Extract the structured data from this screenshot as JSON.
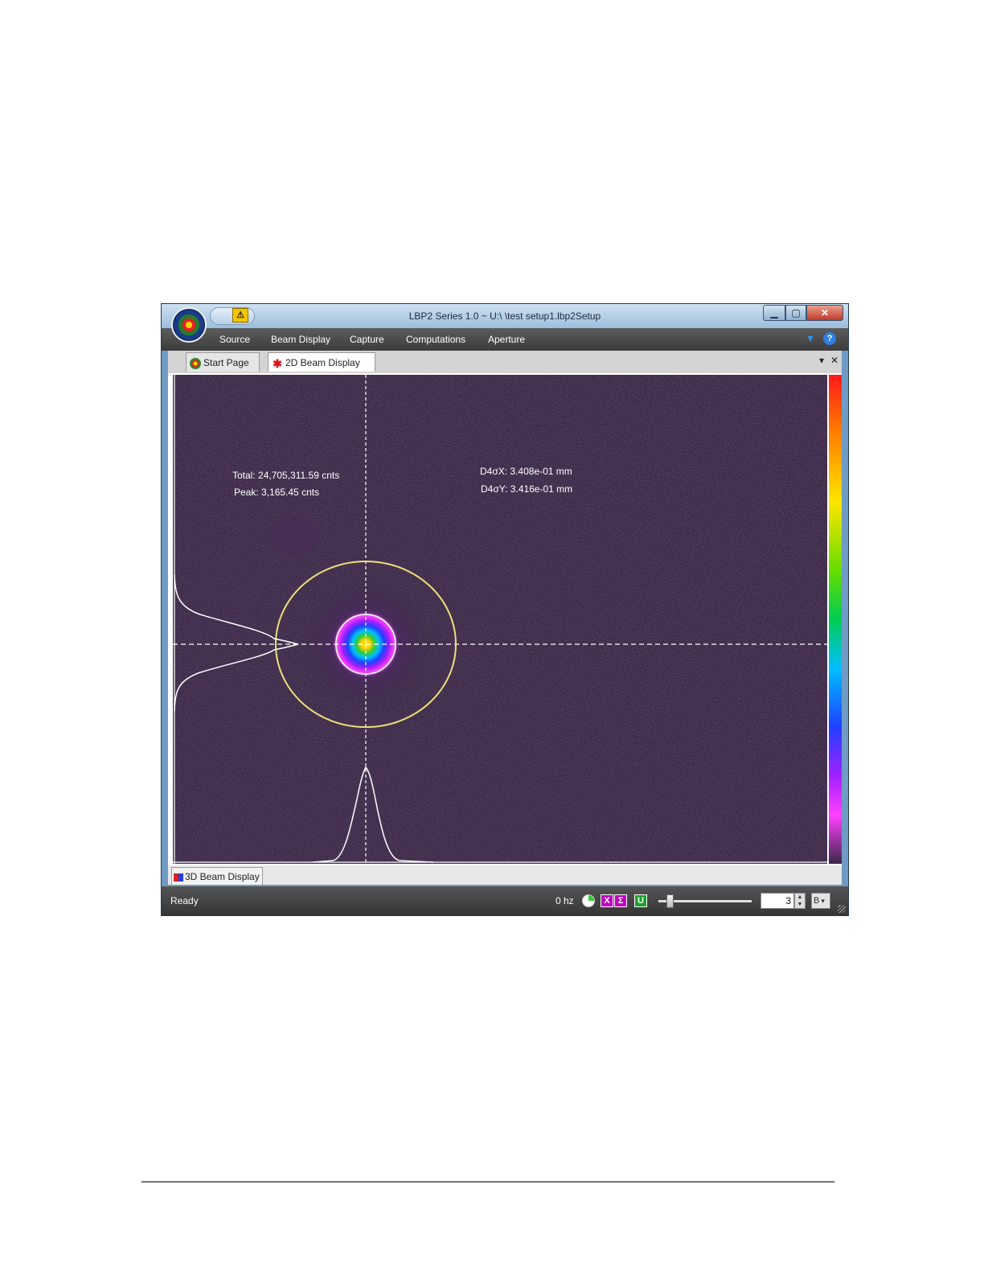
{
  "window": {
    "title": "LBP2 Series 1.0 ~ U:\\                              \\test setup1.lbp2Setup",
    "minimize_icon": "minimize-icon",
    "maximize_icon": "maximize-icon",
    "close_icon": "close-icon"
  },
  "menu": {
    "items": [
      "Source",
      "Beam Display",
      "Capture",
      "Computations",
      "Aperture"
    ],
    "right_icons": [
      "filter-icon",
      "help-icon"
    ]
  },
  "tabs": {
    "items": [
      {
        "label": "Start Page",
        "icon": "start-page-icon"
      },
      {
        "label": "2D Beam Display",
        "icon": "laser-star-icon"
      }
    ],
    "dropdown_glyph": "▾",
    "close_glyph": "✕"
  },
  "beam_display": {
    "total": "Total: 24,705,311.59 cnts",
    "peak": "Peak: 3,165.45 cnts",
    "d4sigma_x": "D4σX: 3.408e-01 mm",
    "d4sigma_y": "D4σY: 3.416e-01 mm",
    "colors": {
      "background": "#3b2847",
      "crosshair": "#ffffff",
      "aperture_ring": "#ece07a",
      "inner_ring": "#e8e8e8"
    },
    "color_scale": [
      "#ff1a1a",
      "#ff8000",
      "#ffe600",
      "#66dd00",
      "#00cc55",
      "#00bfff",
      "#2040ff",
      "#a020ff",
      "#ff40ff",
      "#3b2847"
    ]
  },
  "bottom_tab": {
    "label": "3D Beam Display",
    "icon": "3d-display-icon"
  },
  "status": {
    "text": "Ready",
    "rate": "0 hz",
    "icons": [
      "pie-clock-icon",
      "x-bar-icon",
      "sigma-icon",
      "u-icon"
    ],
    "x_glyph": "X",
    "sigma_glyph": "Σ",
    "u_glyph": "U",
    "spin_value": "3",
    "spin_up": "▲",
    "spin_down": "▼",
    "b_select": "B",
    "b_glyph": "▾"
  }
}
